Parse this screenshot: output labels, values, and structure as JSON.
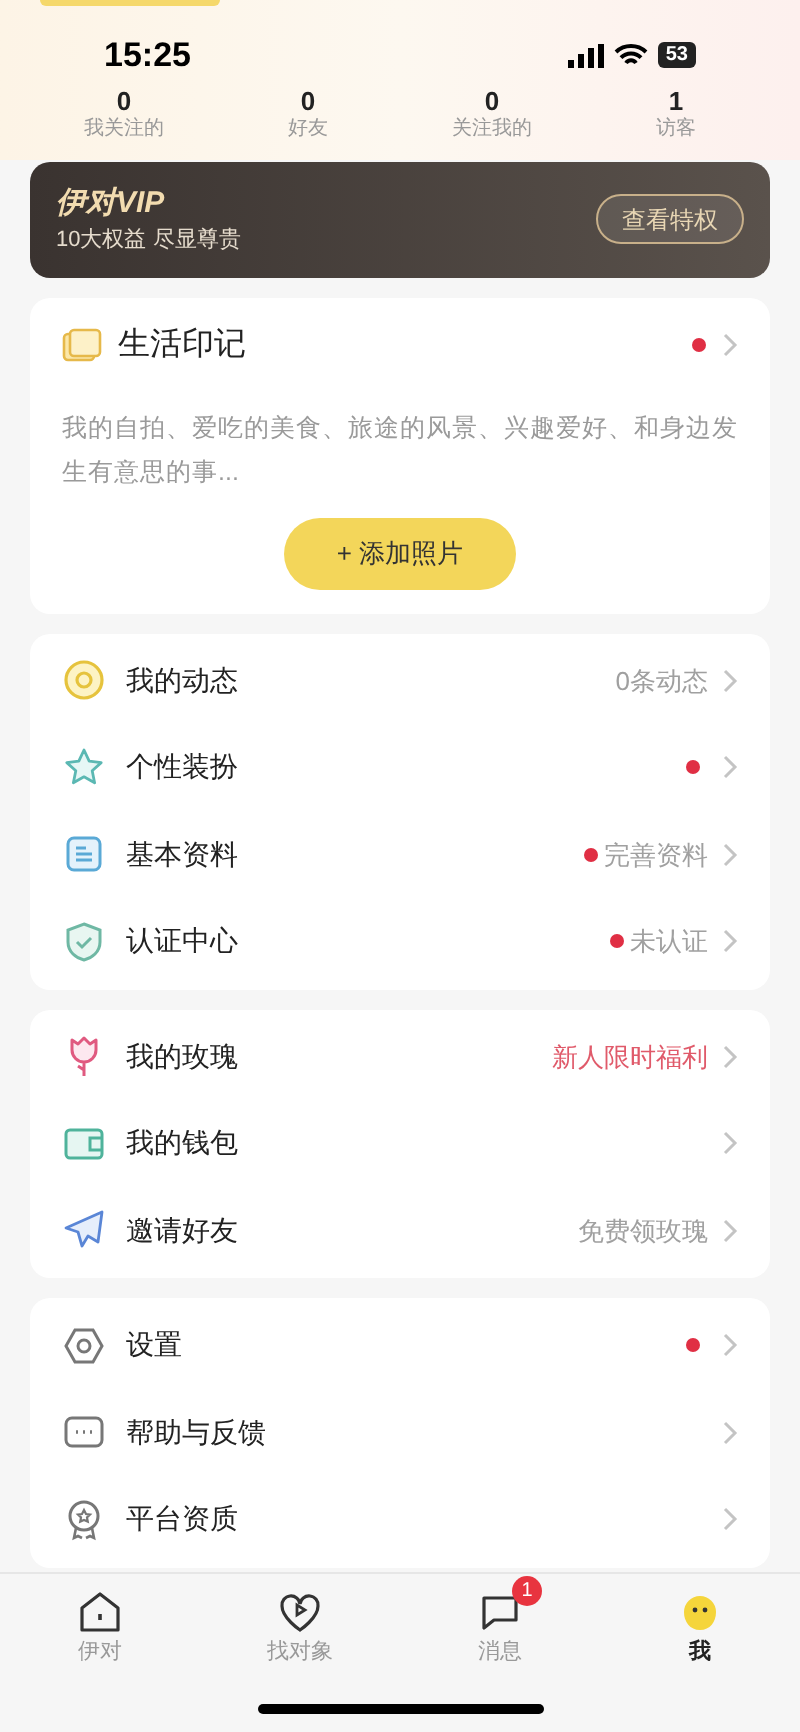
{
  "status_bar": {
    "time": "15:25",
    "battery": "53"
  },
  "stats": [
    {
      "value": "0",
      "label": "我关注的"
    },
    {
      "value": "0",
      "label": "好友"
    },
    {
      "value": "0",
      "label": "关注我的"
    },
    {
      "value": "1",
      "label": "访客"
    }
  ],
  "vip": {
    "title": "伊对VIP",
    "subtitle": "10大权益 尽显尊贵",
    "button": "查看特权"
  },
  "life_card": {
    "title": "生活印记",
    "dot": true,
    "description": "我的自拍、爱吃的美食、旅途的风景、兴趣爱好、和身边发生有意思的事...",
    "button": "+ 添加照片"
  },
  "menu_groups": [
    [
      {
        "label": "我的动态",
        "value": "0条动态",
        "highlight": false,
        "dot": false
      },
      {
        "label": "个性装扮",
        "dot": true
      },
      {
        "label": "基本资料",
        "value": "完善资料",
        "highlight": false,
        "dot": true
      },
      {
        "label": "认证中心",
        "value": "未认证",
        "highlight": false,
        "dot": true
      }
    ],
    [
      {
        "label": "我的玫瑰",
        "value": "新人限时福利",
        "highlight": true,
        "dot": false
      },
      {
        "label": "我的钱包",
        "dot": false
      },
      {
        "label": "邀请好友",
        "value": "免费领玫瑰",
        "highlight": false,
        "dot": false
      }
    ],
    [
      {
        "label": "设置",
        "dot": true
      },
      {
        "label": "帮助与反馈",
        "dot": false
      },
      {
        "label": "平台资质",
        "dot": false
      }
    ]
  ],
  "tab_bar": [
    {
      "label": "伊对",
      "selected": false
    },
    {
      "label": "找对象",
      "selected": false
    },
    {
      "label": "消息",
      "selected": false,
      "badge": "1"
    },
    {
      "label": "我",
      "selected": true
    }
  ]
}
